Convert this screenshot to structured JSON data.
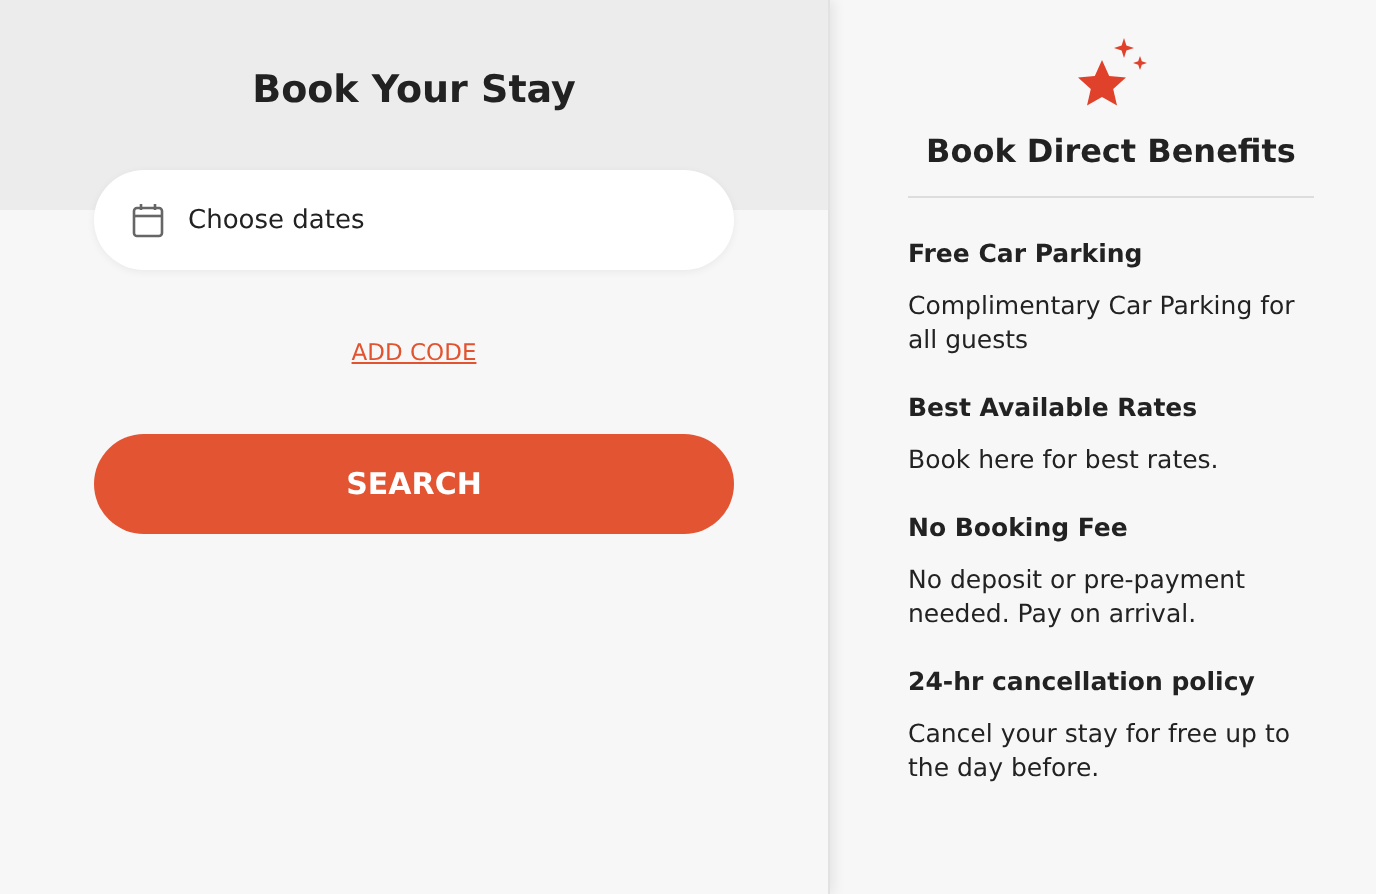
{
  "booking": {
    "title": "Book Your Stay",
    "dates_field": {
      "placeholder": "Choose dates"
    },
    "add_code_link": "ADD CODE",
    "search_button": "SEARCH"
  },
  "benefits": {
    "title": "Book Direct Benefits",
    "items": [
      {
        "heading": "Free Car Parking",
        "text": "Complimentary Car Parking for all guests"
      },
      {
        "heading": "Best Available Rates",
        "text": "Book here for best rates."
      },
      {
        "heading": "No Booking Fee",
        "text": "No deposit or pre-payment needed. Pay on arrival."
      },
      {
        "heading": "24-hr cancellation policy",
        "text": "Cancel your stay for free up to the day before."
      }
    ]
  }
}
